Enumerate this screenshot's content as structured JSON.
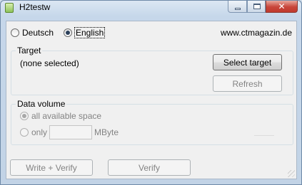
{
  "window": {
    "title": "H2testw"
  },
  "language": {
    "deutsch_label": "Deutsch",
    "english_label": "English",
    "selected": "English"
  },
  "site_link": "www.ctmagazin.de",
  "target": {
    "group_title": "Target",
    "status": "(none selected)",
    "select_button": "Select target",
    "refresh_button": "Refresh"
  },
  "data_volume": {
    "group_title": "Data volume",
    "all_space_label": "all available space",
    "only_label": "only",
    "only_value": "",
    "unit": "MByte"
  },
  "actions": {
    "write_verify_button": "Write + Verify",
    "verify_button": "Verify"
  }
}
